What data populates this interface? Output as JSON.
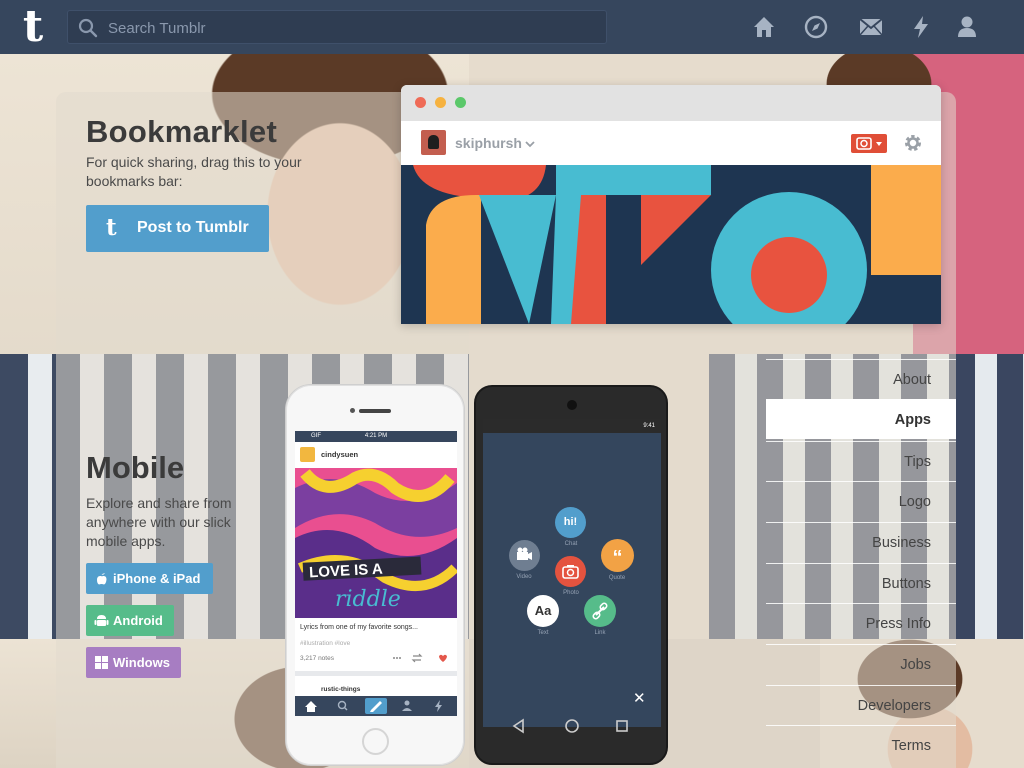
{
  "header": {
    "logo": "t",
    "search_placeholder": "Search Tumblr",
    "nav_icons": [
      "home-icon",
      "explore-icon",
      "inbox-icon",
      "activity-icon",
      "account-icon"
    ]
  },
  "bookmarklet": {
    "title": "Bookmarklet",
    "description": "For quick sharing, drag this to your bookmarks bar:",
    "button_label": "Post to Tumblr",
    "button_icon": "t",
    "preview": {
      "blog_name": "skiphursh",
      "colors": {
        "red": "#e8533f",
        "blue": "#48bcd1",
        "yellow": "#fbac4c",
        "navy": "#1e3551"
      }
    }
  },
  "mobile": {
    "title": "Mobile",
    "description": "Explore and share from anywhere with our slick mobile apps.",
    "buttons": [
      {
        "label": "iPhone & iPad",
        "color": "#529ecc",
        "icon": "apple-icon"
      },
      {
        "label": "Android",
        "color": "#56bc8a",
        "icon": "android-icon"
      },
      {
        "label": "Windows",
        "color": "#a77dc2",
        "icon": "windows-icon"
      }
    ],
    "iphone": {
      "carrier": "GIF",
      "time": "4:21 PM",
      "blog": "cindysuen",
      "art_text_1": "LOVE IS A",
      "art_text_2": "riddle",
      "caption": "Lyrics from one of my favorite songs...",
      "tags": "#illustration  #love",
      "notes": "3,217 notes",
      "next_blog": "rustic-things"
    },
    "android": {
      "time": "9:41",
      "post_types": [
        {
          "symbol": "hi!",
          "label": "Chat"
        },
        {
          "symbol": "“",
          "label": "Quote"
        },
        {
          "symbol": "",
          "label": "Video"
        },
        {
          "symbol": "",
          "label": "Photo"
        },
        {
          "symbol": "Aa",
          "label": "Text"
        },
        {
          "symbol": "",
          "label": "Link"
        }
      ],
      "close": "✕"
    }
  },
  "side_nav": {
    "items": [
      "About",
      "Apps",
      "Tips",
      "Logo",
      "Business",
      "Buttons",
      "Press Info",
      "Jobs",
      "Developers",
      "Terms"
    ],
    "active": "Apps"
  }
}
